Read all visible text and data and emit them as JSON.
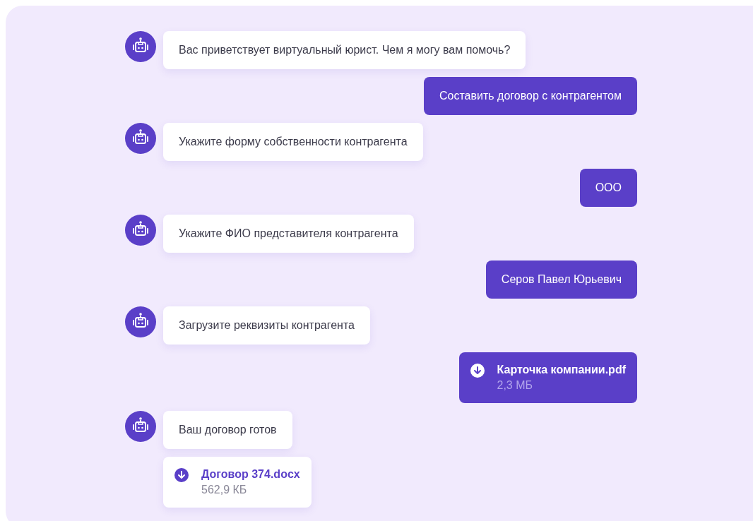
{
  "messages": [
    {
      "kind": "bot_text",
      "text": "Вас приветствует виртуальный юрист. Чем я могу вам помочь?"
    },
    {
      "kind": "user_text",
      "text": "Составить договор с контрагентом"
    },
    {
      "kind": "bot_text",
      "text": "Укажите форму собственности контрагента"
    },
    {
      "kind": "user_text",
      "text": "ООО"
    },
    {
      "kind": "bot_text",
      "text": "Укажите ФИО представителя контрагента"
    },
    {
      "kind": "user_text",
      "text": "Серов Павел Юрьевич"
    },
    {
      "kind": "bot_text",
      "text": "Загрузите реквизиты контрагента"
    },
    {
      "kind": "user_file",
      "name": "Карточка компании.pdf",
      "size": "2,3 МБ"
    },
    {
      "kind": "bot_text",
      "text": "Ваш договор готов"
    },
    {
      "kind": "bot_file",
      "name": "Договор 374.docx",
      "size": "562,9 КБ"
    }
  ]
}
